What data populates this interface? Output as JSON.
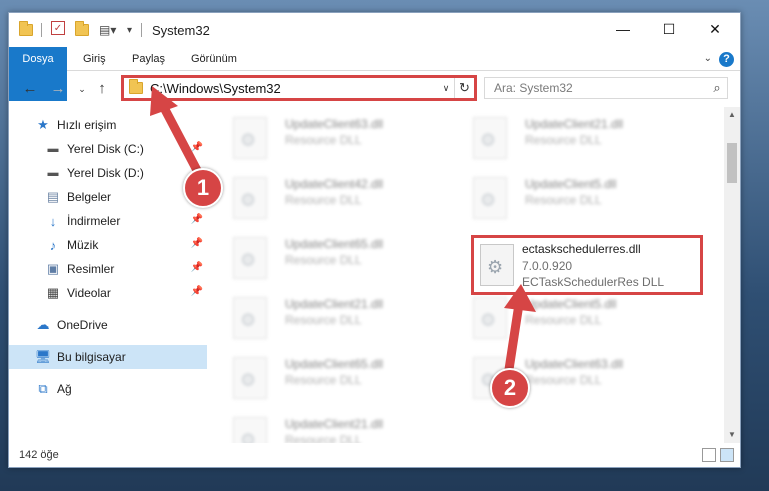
{
  "window": {
    "title": "System32",
    "controls": {
      "minimize": "—",
      "maximize": "☐",
      "close": "✕"
    }
  },
  "ribbon": {
    "tabs": [
      "Dosya",
      "Giriş",
      "Paylaş",
      "Görünüm"
    ],
    "help": "?"
  },
  "address_bar": {
    "path": "C:\\Windows\\System32",
    "search_placeholder": "Ara: System32"
  },
  "sidebar": {
    "items": [
      {
        "label": "Hızlı erişim",
        "icon": "star-icon"
      },
      {
        "label": "Yerel Disk (C:)",
        "icon": "drive-icon",
        "pinned": true
      },
      {
        "label": "Yerel Disk (D:)",
        "icon": "drive-icon"
      },
      {
        "label": "Belgeler",
        "icon": "document-icon"
      },
      {
        "label": "İndirmeler",
        "icon": "download-icon",
        "pinned": true
      },
      {
        "label": "Müzik",
        "icon": "music-icon",
        "pinned": true
      },
      {
        "label": "Resimler",
        "icon": "pictures-icon",
        "pinned": true
      },
      {
        "label": "Videolar",
        "icon": "video-icon",
        "pinned": true
      },
      {
        "label": "OneDrive",
        "icon": "cloud-icon"
      },
      {
        "label": "Bu bilgisayar",
        "icon": "computer-icon",
        "selected": true
      },
      {
        "label": "Ağ",
        "icon": "network-icon"
      }
    ]
  },
  "files": [
    {
      "name": "UpdateClient63.dll",
      "desc": "Resource DLL"
    },
    {
      "name": "UpdateClient21.dll",
      "desc": "Resource DLL"
    },
    {
      "name": "UpdateClient42.dll",
      "desc": "Resource DLL"
    },
    {
      "name": "UpdateClient5.dll",
      "desc": "Resource DLL"
    },
    {
      "name": "UpdateClient65.dll",
      "desc": "Resource DLL"
    },
    {
      "name": "UpdateClient21.dll",
      "desc": "Resource DLL"
    },
    {
      "name": "UpdateClient5.dll",
      "desc": "Resource DLL"
    },
    {
      "name": "UpdateClient65.dll",
      "desc": "Resource DLL"
    },
    {
      "name": "UpdateClient63.dll",
      "desc": "Resource DLL"
    },
    {
      "name": "UpdateClient21.dll",
      "desc": "Resource DLL"
    }
  ],
  "highlighted_file": {
    "name": "ectaskschedulerres.dll",
    "version": "7.0.0.920",
    "desc": "ECTaskSchedulerRes DLL"
  },
  "status_bar": {
    "count": "142 öğe"
  },
  "callouts": [
    "1",
    "2"
  ],
  "colors": {
    "accent": "#1979ca",
    "annotation": "#d64545",
    "selection": "#cce4f7"
  }
}
